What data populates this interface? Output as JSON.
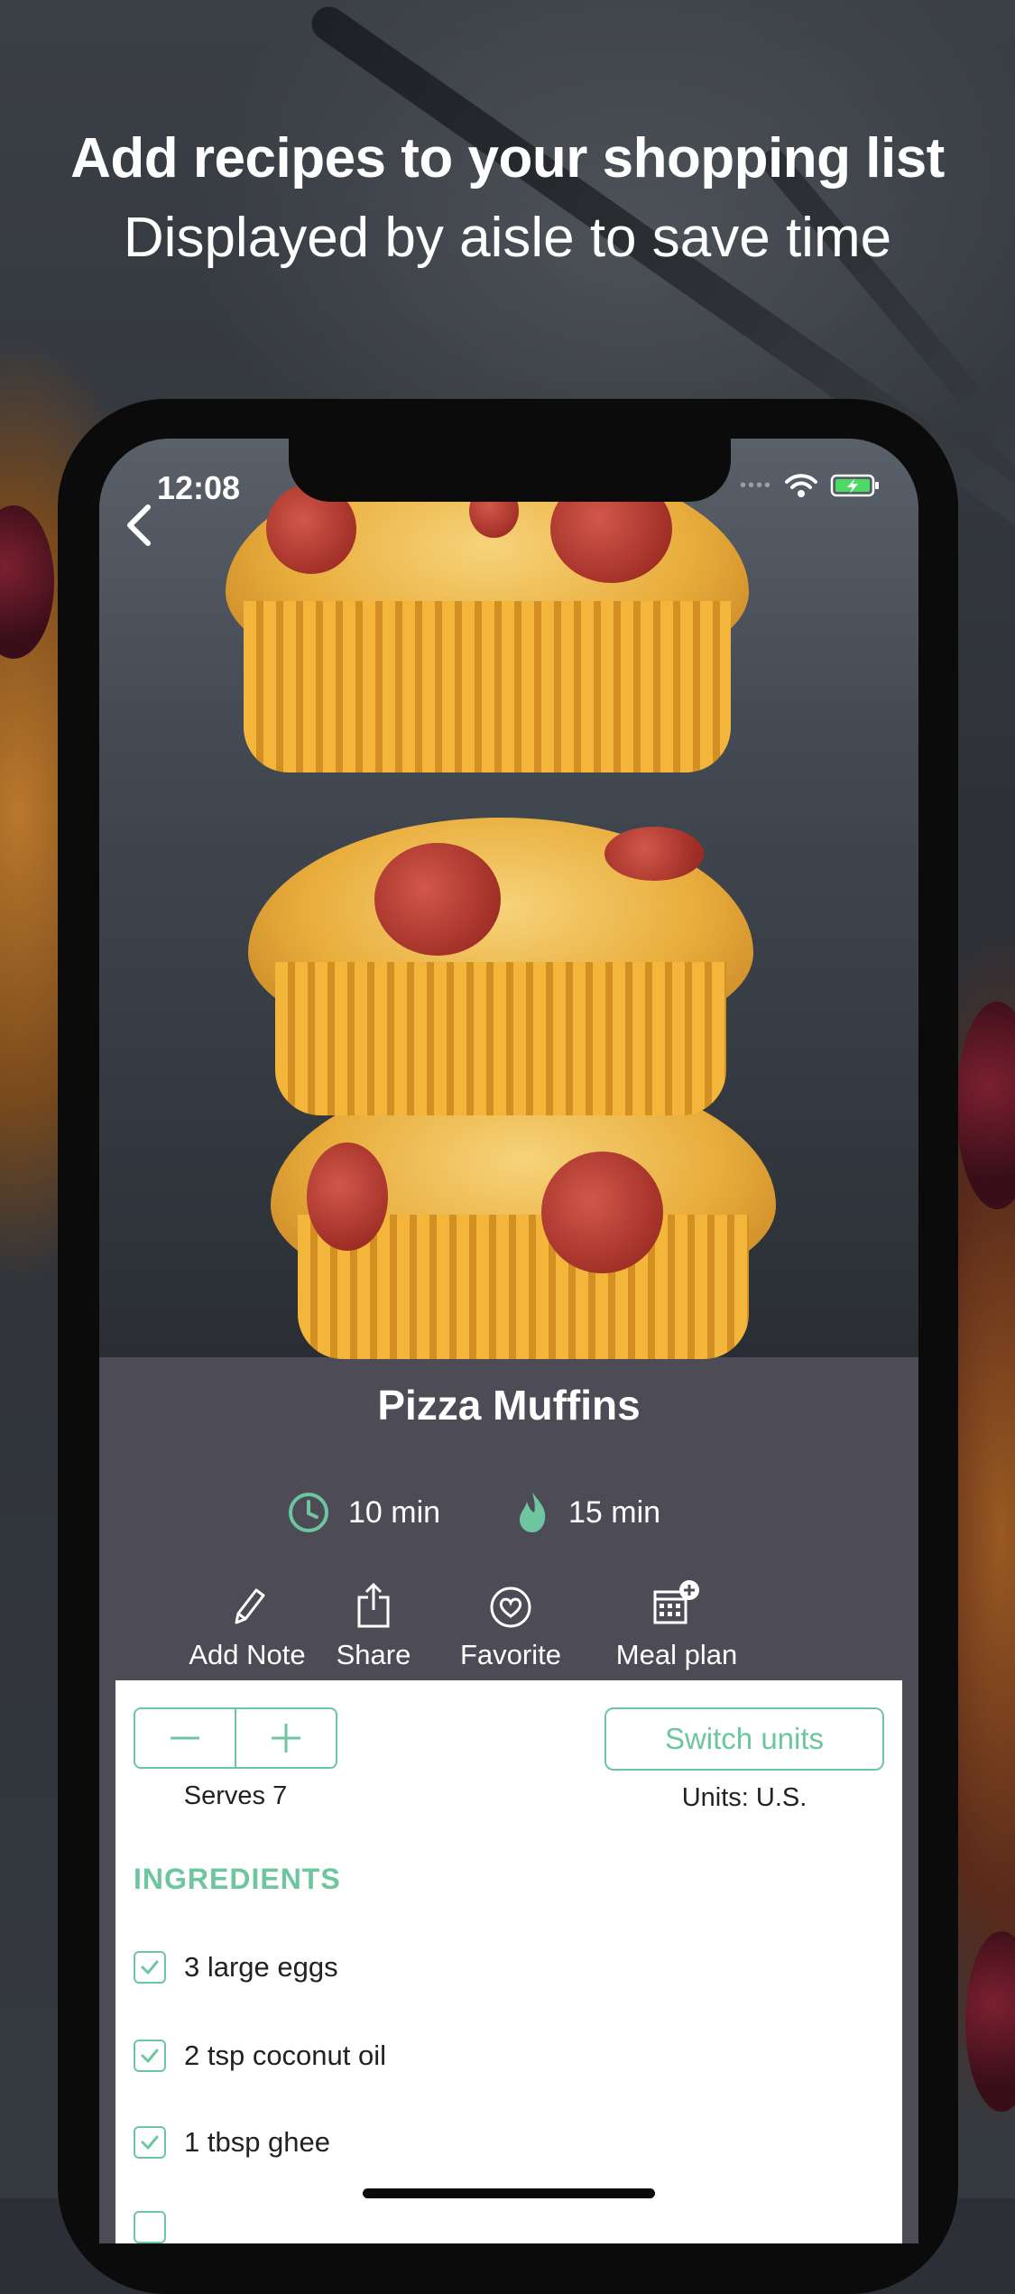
{
  "promo": {
    "headline": "Add recipes to your shopping list",
    "subheadline": "Displayed by aisle to save time"
  },
  "status_bar": {
    "time": "12:08",
    "icons": [
      "signal-dots-icon",
      "wifi-icon",
      "battery-charging-icon"
    ]
  },
  "recipe": {
    "title": "Pizza Muffins",
    "prep_time": "10 min",
    "cook_time": "15 min",
    "prep_icon": "clock-icon",
    "cook_icon": "flame-icon"
  },
  "actions": [
    {
      "label": "Add Note",
      "icon": "pencil-icon"
    },
    {
      "label": "Share",
      "icon": "share-icon"
    },
    {
      "label": "Favorite",
      "icon": "heart-icon"
    },
    {
      "label": "Meal plan",
      "icon": "calendar-add-icon"
    }
  ],
  "servings": {
    "label": "Serves 7",
    "decrement_icon": "minus-icon",
    "increment_icon": "plus-icon"
  },
  "units": {
    "button_label": "Switch units",
    "current": "Units: U.S."
  },
  "ingredients": {
    "heading": "INGREDIENTS",
    "items": [
      {
        "text": "3 large eggs",
        "checked": true
      },
      {
        "text": "2 tsp coconut oil",
        "checked": true
      },
      {
        "text": "1 tbsp ghee",
        "checked": true
      }
    ]
  },
  "colors": {
    "accent": "#6ec6a0",
    "header_bg": "#4c4b56",
    "panel_bg": "#ffffff"
  }
}
